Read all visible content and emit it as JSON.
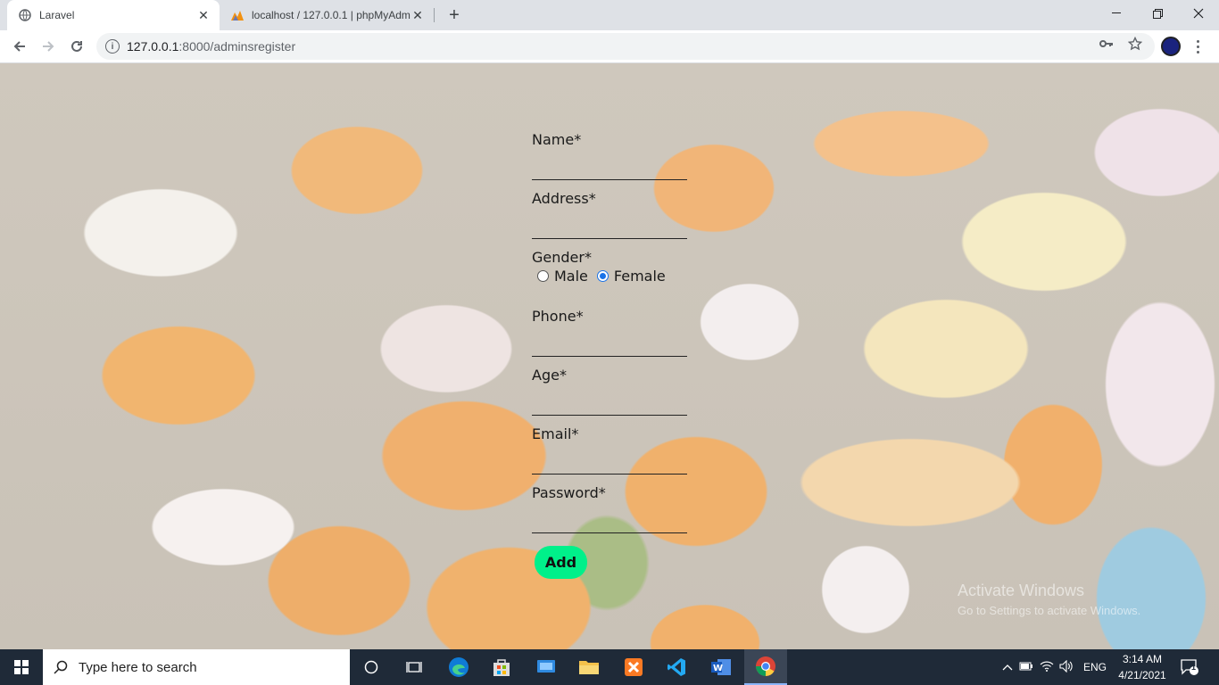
{
  "browser": {
    "tabs": [
      {
        "title": "Laravel",
        "active": true
      },
      {
        "title": "localhost / 127.0.0.1 | phpMyAdm",
        "active": false
      }
    ],
    "url_host": "127.0.0.1",
    "url_path": ":8000/adminsregister"
  },
  "form": {
    "name_label": "Name*",
    "address_label": "Address*",
    "gender_label": "Gender*",
    "gender_options": [
      "Male",
      "Female"
    ],
    "gender_selected": "Female",
    "phone_label": "Phone*",
    "age_label": "Age*",
    "email_label": "Email*",
    "password_label": "Password*",
    "submit_label": "Add",
    "submit_color": "#00f08a"
  },
  "watermark": {
    "line1": "Activate Windows",
    "line2": "Go to Settings to activate Windows."
  },
  "taskbar": {
    "search_placeholder": "Type here to search",
    "language": "ENG",
    "time": "3:14 AM",
    "date": "4/21/2021",
    "notification_count": "1",
    "apps": [
      "task-view-icon",
      "edge-icon",
      "store-icon",
      "remote-desktop-icon",
      "file-explorer-icon",
      "xampp-icon",
      "vscode-icon",
      "word-icon",
      "chrome-icon"
    ]
  }
}
